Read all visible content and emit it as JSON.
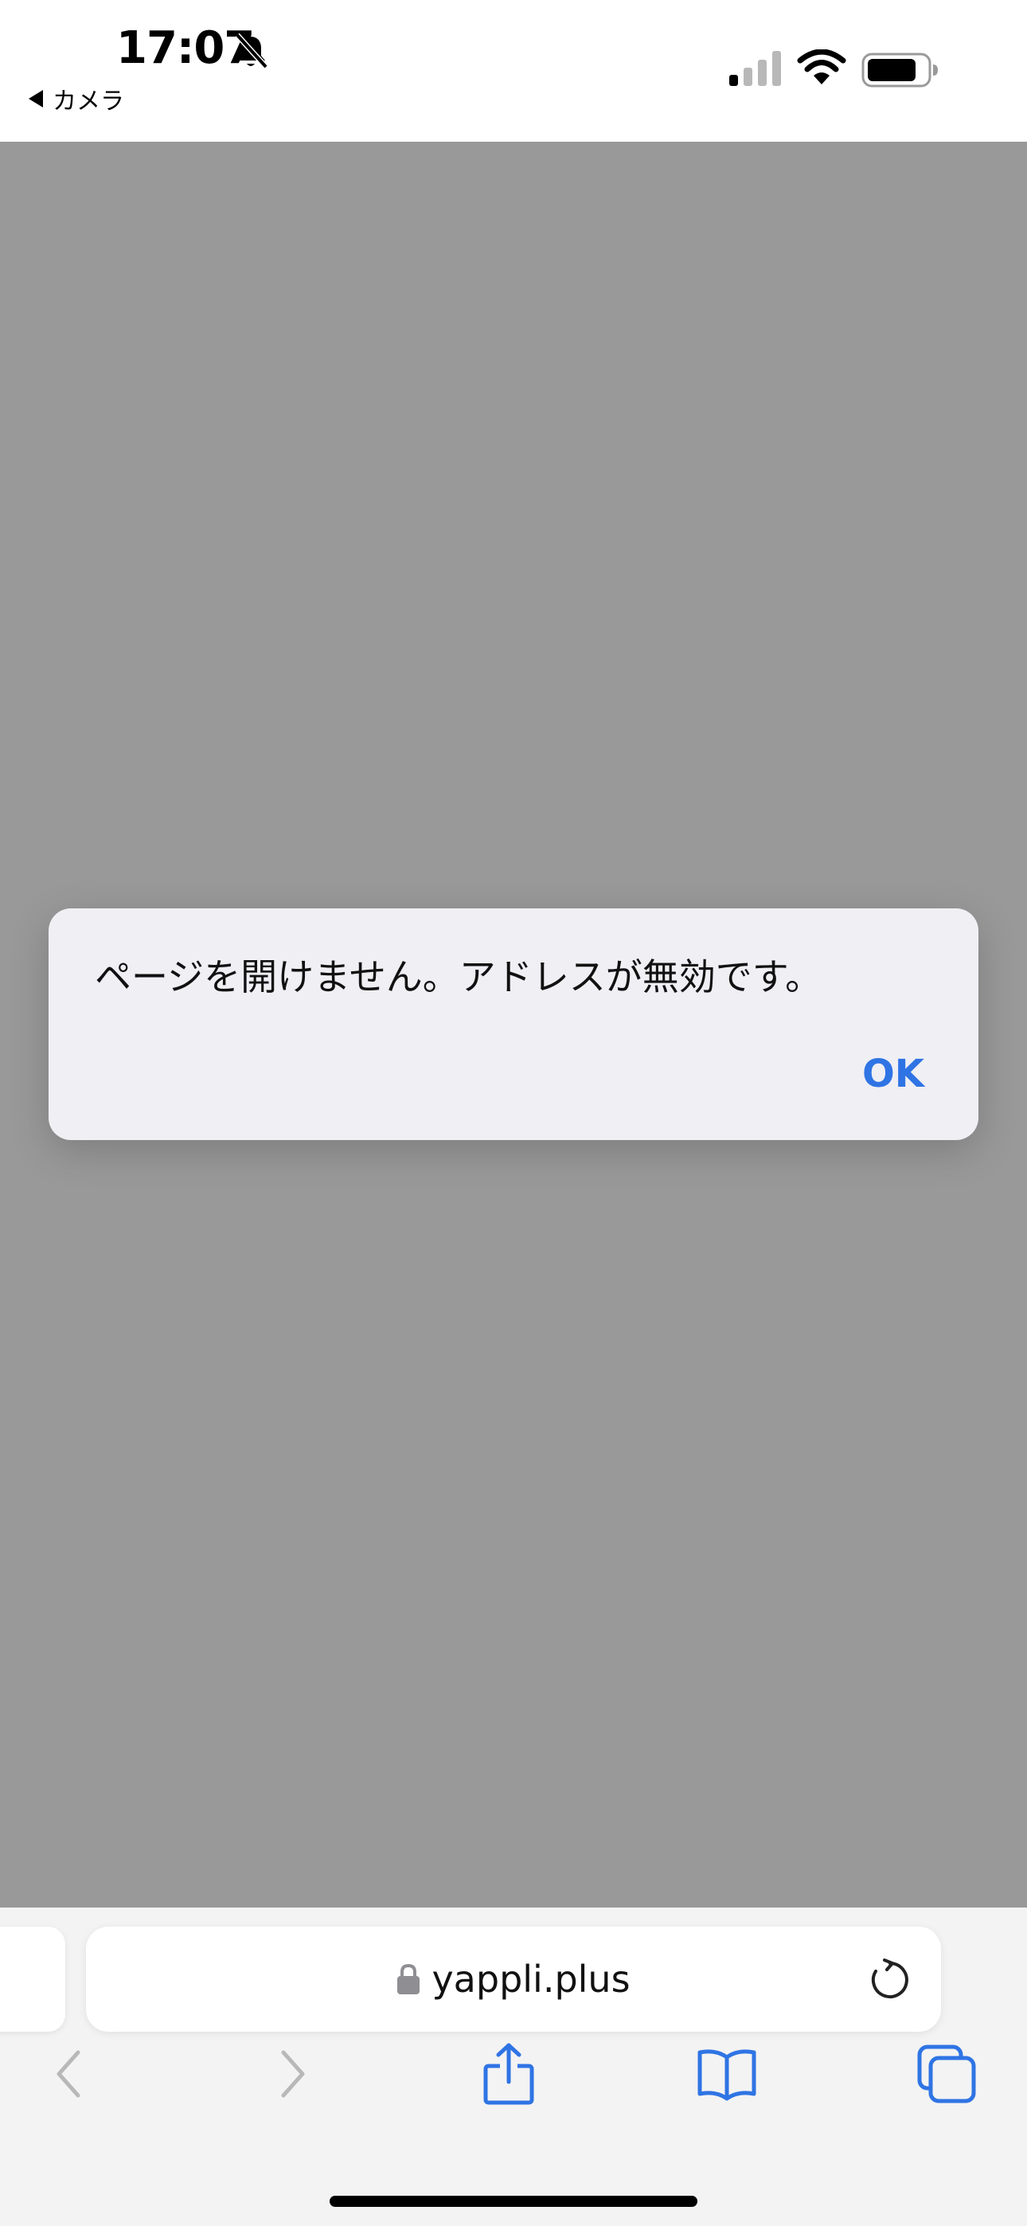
{
  "status_bar": {
    "time": "17:07",
    "back_app_label": "カメラ",
    "silent_icon": "bell-slash-icon",
    "signal_icon": "cellular-signal-icon",
    "wifi_icon": "wifi-icon",
    "battery_icon": "battery-icon"
  },
  "alert": {
    "message": "ページを開けません。アドレスが無効です。",
    "ok_label": "OK"
  },
  "address_bar": {
    "url": "yappli.plus",
    "lock_icon": "lock-icon",
    "reload_icon": "reload-icon"
  },
  "toolbar": {
    "items": [
      "back-icon",
      "forward-icon",
      "share-icon",
      "bookmarks-icon",
      "tabs-icon"
    ]
  },
  "colors": {
    "accent": "#2f74e4",
    "overlay": "#999999",
    "alert_bg": "#efeff4",
    "disabled": "#b8b8b8"
  }
}
